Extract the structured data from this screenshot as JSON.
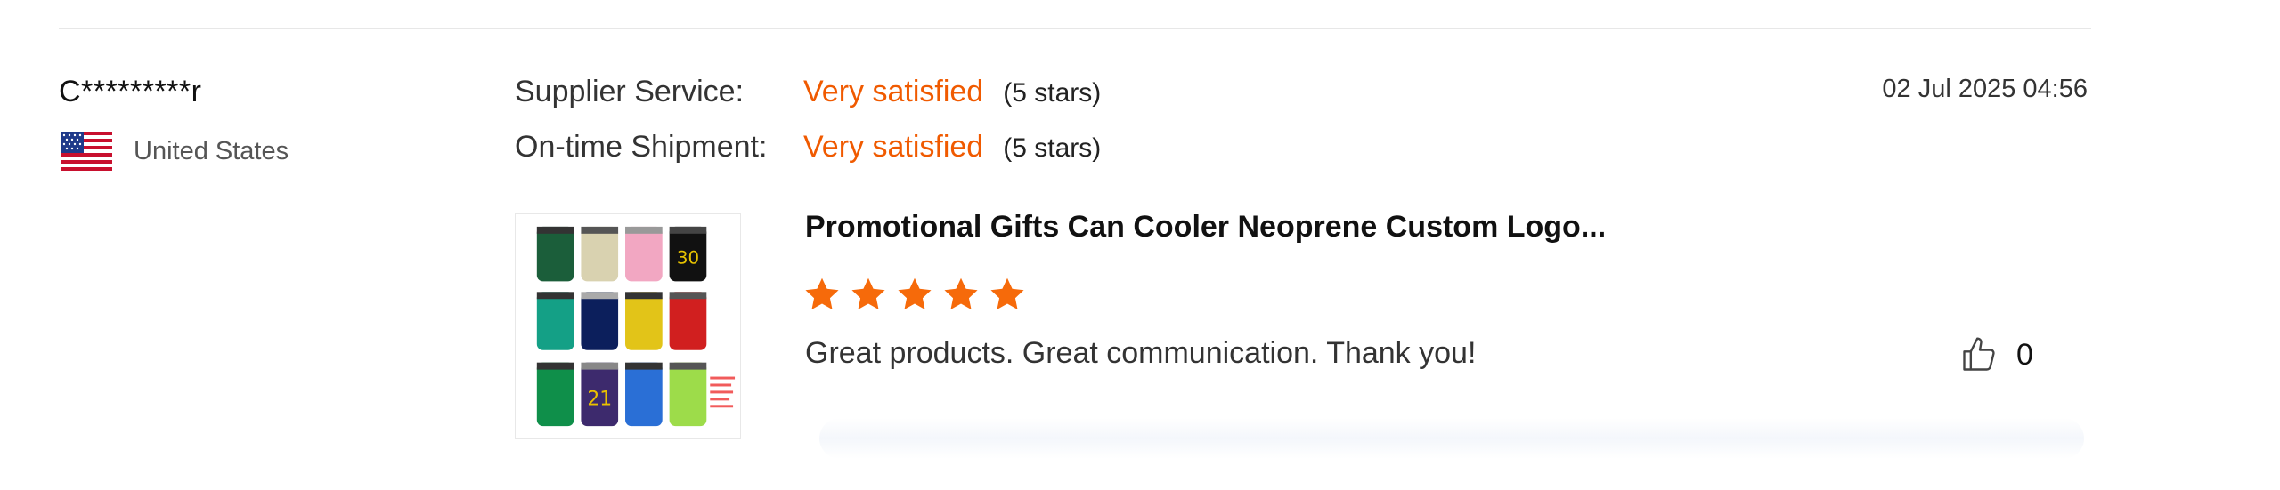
{
  "review": {
    "reviewer_name": "C*********r",
    "country": "United States",
    "date": "02 Jul 2025 04:56",
    "ratings": [
      {
        "label": "Supplier Service:",
        "value": "Very satisfied",
        "stars_text": "(5 stars)"
      },
      {
        "label": "On-time Shipment:",
        "value": "Very satisfied",
        "stars_text": "(5 stars)"
      }
    ],
    "product_title": "Promotional Gifts Can Cooler Neoprene Custom Logo...",
    "product_rating": 5,
    "text": "Great products. Great communication. Thank you!",
    "like_count": "0"
  },
  "colors": {
    "accent": "#f05a00",
    "star": "#f66a0a"
  },
  "icons": {
    "flag": "us-flag-icon",
    "star": "star-icon",
    "like": "thumbs-up-icon"
  }
}
